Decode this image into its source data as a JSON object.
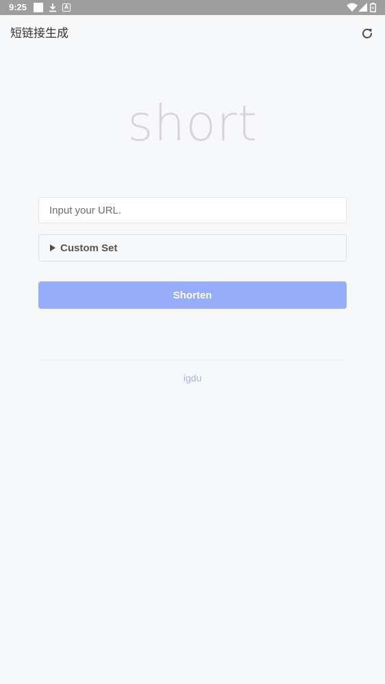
{
  "status_bar": {
    "time": "9:25",
    "notification_letter": "A"
  },
  "app_bar": {
    "title": "短链接生成",
    "refresh_icon": "refresh-icon"
  },
  "logo": {
    "text": "short"
  },
  "url_input": {
    "placeholder": "Input your URL.",
    "value": ""
  },
  "custom_set": {
    "label": "Custom Set",
    "expanded": false
  },
  "shorten_button": {
    "label": "Shorten",
    "color": "#98adf9"
  },
  "footer": {
    "link_text": "igdu",
    "link_color": "#a5b2e8"
  },
  "colors": {
    "background": "#f7f8fa",
    "status_bar": "#9e9e9e",
    "logo": "#d6d6d8"
  }
}
